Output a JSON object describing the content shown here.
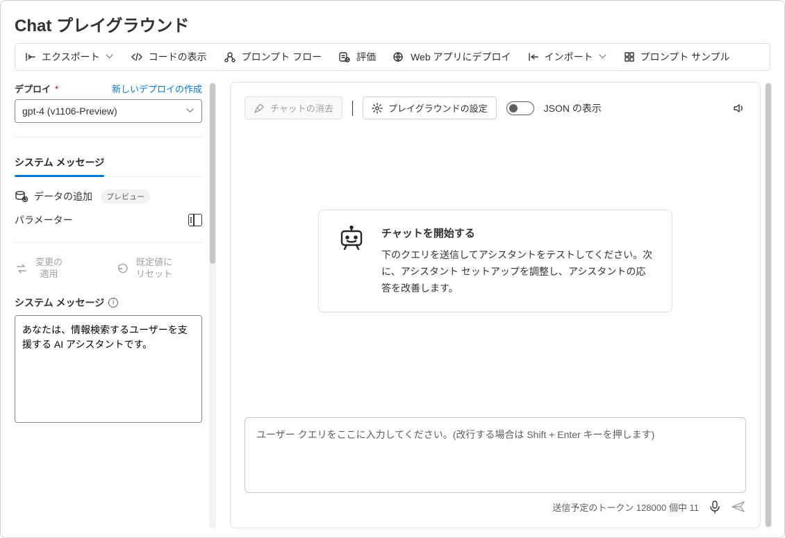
{
  "page": {
    "title": "Chat プレイグラウンド"
  },
  "toolbar": {
    "export": "エクスポート",
    "show_code": "コードの表示",
    "prompt_flow": "プロンプト フロー",
    "evaluate": "評価",
    "deploy_web": "Web アプリにデプロイ",
    "import": "インポート",
    "prompt_samples": "プロンプト サンプル"
  },
  "sidebar": {
    "deploy_label": "デプロイ",
    "new_deploy_link": "新しいデプロイの作成",
    "deploy_value": "gpt-4 (v1106-Preview)",
    "tab_system": "システム メッセージ",
    "add_data_label": "データの追加",
    "preview_badge": "プレビュー",
    "parameters_label": "パラメーター",
    "apply_changes_line1": "変更の",
    "apply_changes_line2": "適用",
    "reset_default_line1": "既定値に",
    "reset_default_line2": "リセット",
    "system_message_label": "システム メッセージ",
    "system_message_value": "あなたは、情報検索するユーザーを支援する AI アシスタントです。"
  },
  "chat": {
    "clear_chat": "チャットの消去",
    "playground_settings": "プレイグラウンドの設定",
    "show_json": "JSON の表示",
    "welcome_title": "チャットを開始する",
    "welcome_body": "下のクエリを送信してアシスタントをテストしてください。次に、アシスタント セットアップを調整し、アシスタントの応答を改善します。",
    "input_placeholder": "ユーザー クエリをここに入力してください。(改行する場合は Shift + Enter キーを押します)",
    "token_footer_prefix": "送信予定のトークン",
    "token_limit": "128000",
    "token_footer_mid": "個中",
    "token_used": "11"
  }
}
